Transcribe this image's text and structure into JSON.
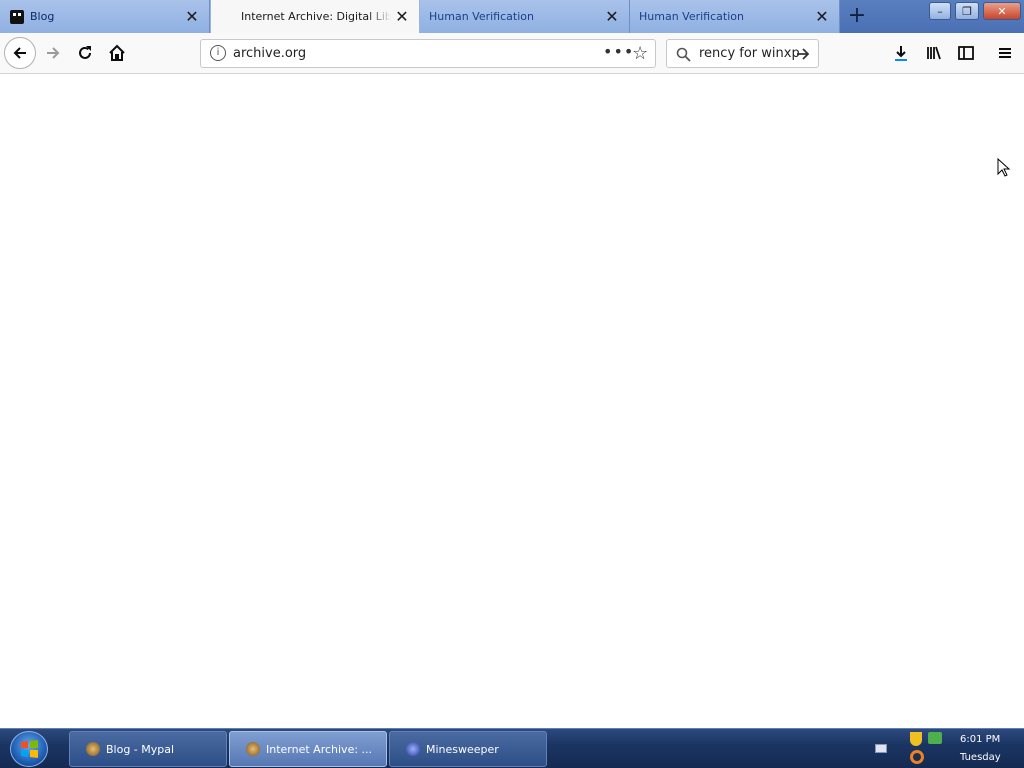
{
  "browser": {
    "tabs": [
      {
        "title": "Blog",
        "active": false
      },
      {
        "title": "Internet Archive: Digital Library",
        "active": true
      },
      {
        "title": "Human Verification",
        "active": false
      },
      {
        "title": "Human Verification",
        "active": false
      }
    ],
    "url": "archive.org",
    "search_text": "rency for winxp"
  },
  "taskbar": {
    "items": [
      {
        "label": "Blog - Mypal"
      },
      {
        "label": "Internet Archive: ..."
      },
      {
        "label": "Minesweeper"
      }
    ],
    "clock_time": "6:01 PM",
    "clock_day": "Tuesday"
  },
  "colors": {
    "tab_bar": "#4a70b4",
    "taskbar": "#1b3563",
    "page_background": "#ffffff"
  }
}
